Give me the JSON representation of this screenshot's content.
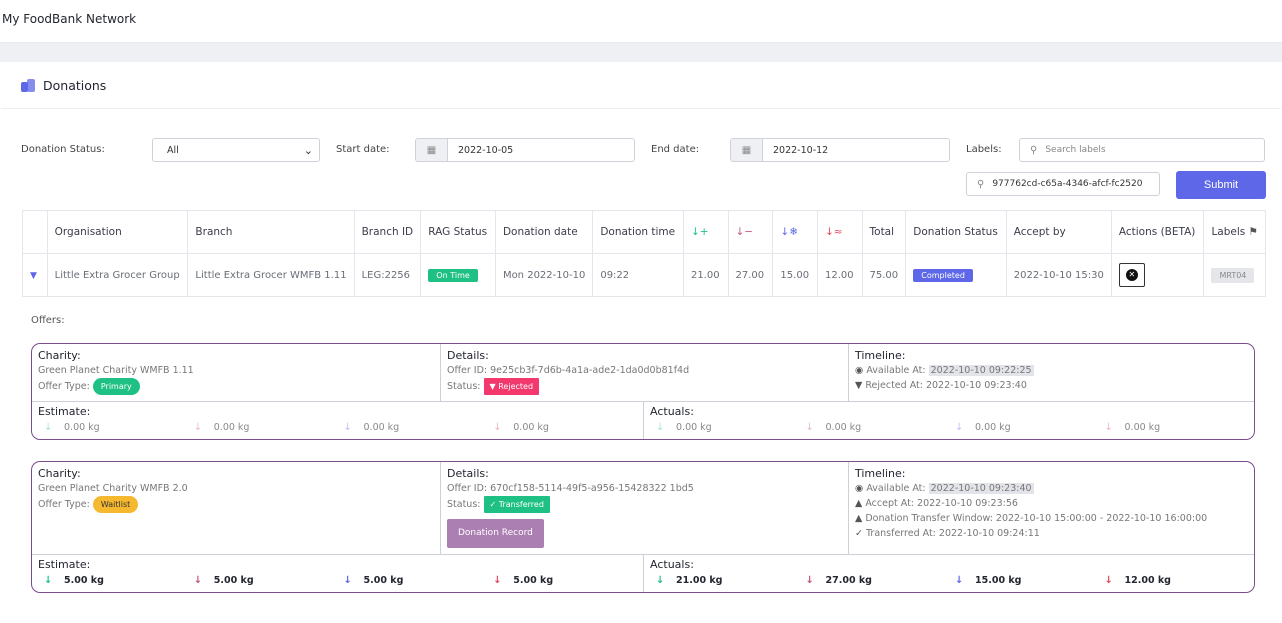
{
  "app": {
    "title": "My FoodBank Network"
  },
  "panel": {
    "title": "Donations"
  },
  "filters": {
    "status_label": "Donation Status:",
    "status_value": "All",
    "start_label": "Start date:",
    "start_value": "2022-10-05",
    "end_label": "End date:",
    "end_value": "2022-10-12",
    "labels_label": "Labels:",
    "labels_placeholder": "Search labels",
    "id_search_value": "977762cd-c65a-4346-afcf-fc2520",
    "submit_label": "Submit"
  },
  "table": {
    "headers": [
      "Organisation",
      "Branch",
      "Branch ID",
      "RAG Status",
      "Donation date",
      "Donation time",
      "Total",
      "Donation Status",
      "Accept by",
      "Actions (BETA)",
      "Labels"
    ],
    "row": {
      "organisation": "Little Extra Grocer Group",
      "branch": "Little Extra Grocer WMFB 1.11",
      "branch_id": "LEG:2256",
      "rag": "On Time",
      "date": "Mon 2022-10-10",
      "time": "09:22",
      "ambient": "21.00",
      "chilled": "27.00",
      "frozen": "15.00",
      "hot": "12.00",
      "total": "75.00",
      "status": "Completed",
      "accept_by": "2022-10-10 15:30",
      "label": "MRT04"
    }
  },
  "offers_label": "Offers:",
  "offers": [
    {
      "charity_h": "Charity:",
      "charity": "Green Planet Charity WMFB 1.11",
      "offer_type_label": "Offer Type:",
      "offer_type": "Primary",
      "details_h": "Details:",
      "offer_id": "Offer ID: 9e25cb3f-7d6b-4a1a-ade2-1da0d0b81f4d",
      "status_label": "Status:",
      "status": "Rejected",
      "timeline_h": "Timeline:",
      "t1_label": "Available At:",
      "t1_value": "2022-10-10 09:22:25",
      "t2": "Rejected At:  2022-10-10 09:23:40",
      "estimate_h": "Estimate:",
      "actuals_h": "Actuals:",
      "estimate": [
        "0.00 kg",
        "0.00 kg",
        "0.00 kg",
        "0.00 kg"
      ],
      "actuals": [
        "0.00 kg",
        "0.00 kg",
        "0.00 kg",
        "0.00 kg"
      ]
    },
    {
      "charity_h": "Charity:",
      "charity": "Green Planet Charity WMFB 2.0",
      "offer_type_label": "Offer Type:",
      "offer_type": "Waitlist",
      "details_h": "Details:",
      "offer_id": "Offer ID: 670cf158-5114-49f5-a956-15428322 1bd5",
      "status_label": "Status:",
      "status": "Transferred",
      "record_btn": "Donation Record",
      "timeline_h": "Timeline:",
      "t1_label": "Available At:",
      "t1_value": "2022-10-10 09:23:40",
      "t2": "Accept At:  2022-10-10 09:23:56",
      "t3": "Donation Transfer Window: 2022-10-10 15:00:00 - 2022-10-10 16:00:00",
      "t4": "Transferred At:  2022-10-10 09:24:11",
      "estimate_h": "Estimate:",
      "actuals_h": "Actuals:",
      "estimate": [
        "5.00 kg",
        "5.00 kg",
        "5.00 kg",
        "5.00 kg"
      ],
      "actuals": [
        "21.00 kg",
        "27.00 kg",
        "15.00 kg",
        "12.00 kg"
      ]
    }
  ],
  "colors": {
    "accent": "#5d67e8",
    "success": "#1ec183",
    "danger": "#f2386d",
    "warning": "#f5b82e",
    "card_border": "#7b4d8d"
  }
}
